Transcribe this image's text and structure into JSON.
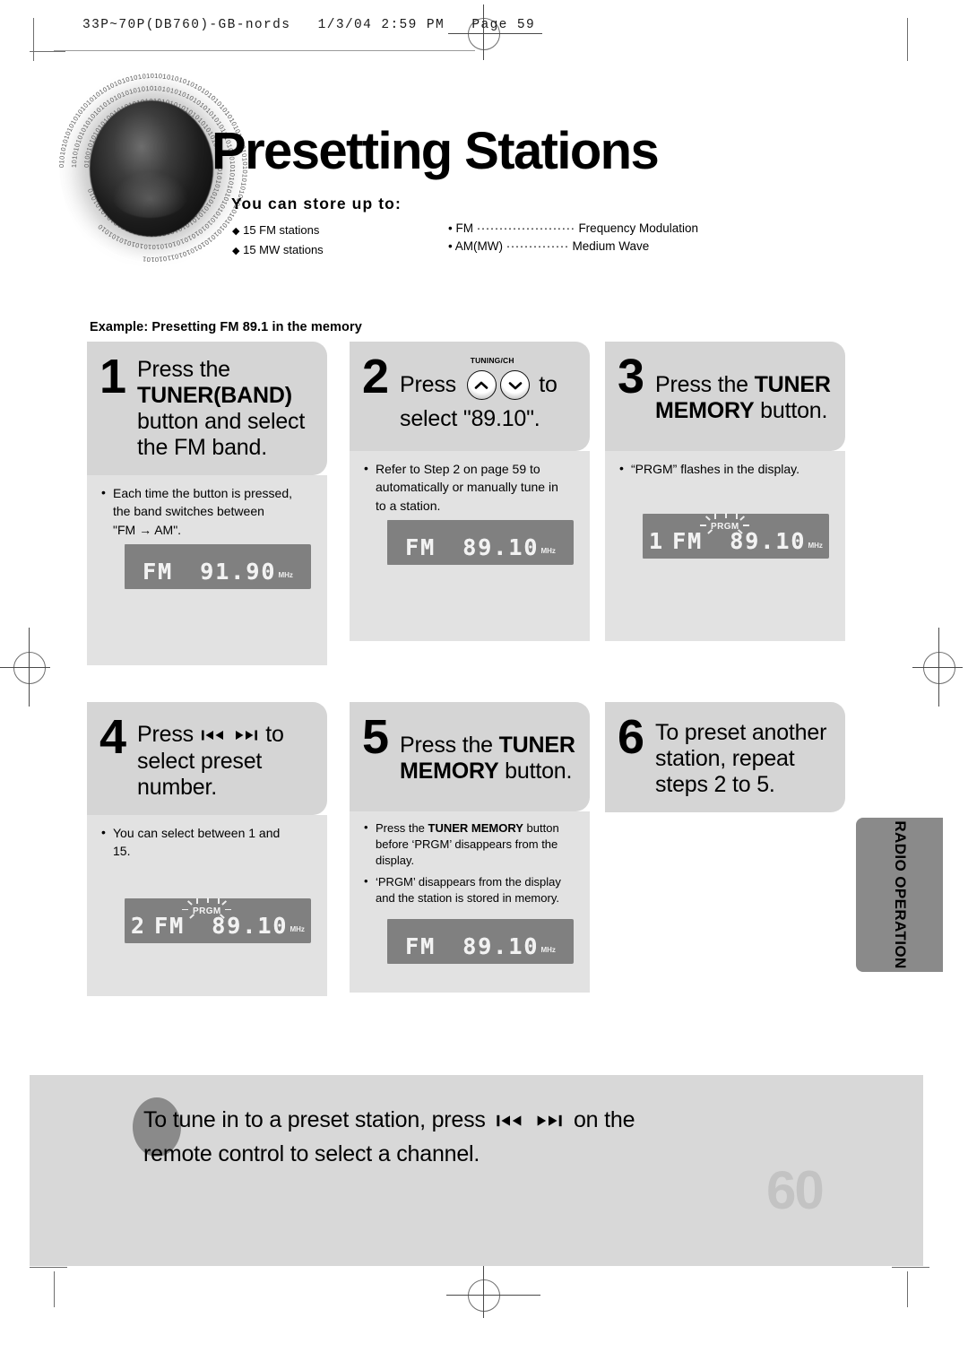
{
  "print_header": {
    "text": "33P~70P(DB760)-GB-nords   1/3/04 2:59 PM   Page 59"
  },
  "heading": {
    "title": "Presetting Stations",
    "store_label": "You can store up to:",
    "capacity": [
      "15 FM stations",
      "15 MW stations"
    ],
    "abbreviations": [
      {
        "term": "FM",
        "dots": "······················",
        "meaning": "Frequency Modulation"
      },
      {
        "term": "AM(MW)",
        "dots": "··············",
        "meaning": "Medium Wave"
      }
    ]
  },
  "example_caption": "Example: Presetting FM 89.1 in the memory",
  "steps": [
    {
      "number": "1",
      "text_lines": [
        {
          "plain": "Press the"
        },
        {
          "bold": "TUNER(BAND)"
        },
        {
          "plain": "button  and select"
        },
        {
          "plain": "the FM band."
        }
      ],
      "notes": [
        "Each time the button is pressed, the band switches between \"FM → AM\"."
      ],
      "lcd": {
        "preset": "",
        "band": "FM",
        "freq": "91.90",
        "unit": "MHz",
        "prgm": false
      }
    },
    {
      "number": "2",
      "text_lines": [
        {
          "plain": "Press",
          "icon": "tuning-buttons",
          "icon_label": "TUNING/CH",
          "plain_after": "to"
        },
        {
          "plain": "select \"89.10\"."
        }
      ],
      "notes": [
        "Refer to Step 2 on page 59 to automatically or manually tune in to a station."
      ],
      "lcd": {
        "preset": "",
        "band": "FM",
        "freq": "89.10",
        "unit": "MHz",
        "prgm": false
      }
    },
    {
      "number": "3",
      "text_lines": [
        {
          "plain": "Press the",
          "bold_after": "TUNER"
        },
        {
          "bold": "MEMORY",
          "plain_after": "button."
        }
      ],
      "notes": [
        "“PRGM” flashes in the display."
      ],
      "lcd": {
        "preset": "1",
        "band": "FM",
        "freq": "89.10",
        "unit": "MHz",
        "prgm": true
      }
    },
    {
      "number": "4",
      "text_lines": [
        {
          "plain": "Press",
          "icon": "skip-buttons",
          "plain_after": "to"
        },
        {
          "plain": "select preset"
        },
        {
          "plain": "number."
        }
      ],
      "notes": [
        "You can select between 1 and 15."
      ],
      "lcd": {
        "preset": "2",
        "band": "FM",
        "freq": "89.10",
        "unit": "MHz",
        "prgm": true
      }
    },
    {
      "number": "5",
      "text_lines": [
        {
          "plain": "Press the",
          "bold_after": "TUNER"
        },
        {
          "bold": "MEMORY",
          "plain_after": "button."
        }
      ],
      "notes": [
        "Press the TUNER MEMORY button before ‘PRGM’ disappears from the display.",
        "‘PRGM’ disappears from the display and the station is stored in memory."
      ],
      "lcd": {
        "preset": "",
        "band": "FM",
        "freq": "89.10",
        "unit": "MHz",
        "prgm": false
      }
    },
    {
      "number": "6",
      "text_lines": [
        {
          "plain": "To preset another"
        },
        {
          "plain": "station, repeat"
        },
        {
          "plain": "steps 2 to 5."
        }
      ],
      "notes": [],
      "lcd": null
    }
  ],
  "step_notes_text": {
    "s1_l1": "Each time the button is pressed,",
    "s1_l2": "the band switches between",
    "s1_l3": "\"FM → AM\".",
    "s2_l1": "Refer to Step 2 on page 59 to",
    "s2_l2": "automatically or manually tune in",
    "s2_l3": "to a station.",
    "s3_l1": "“PRGM” flashes in the display.",
    "s4_l1": "You can select between 1 and",
    "s4_l2": "15.",
    "s5_a1": "Press the ",
    "s5_a_bold": "TUNER MEMORY",
    "s5_a2": " button before ‘PRGM’ disappears from the display.",
    "s5_b": "‘PRGM’ disappears from the display and the station is stored in memory."
  },
  "step_headings": {
    "s1_l1": "Press the",
    "s1_l2": "TUNER(BAND)",
    "s1_l3": "button  and select",
    "s1_l4": "the FM band.",
    "s2_press": "Press",
    "s2_to": "to",
    "s2_l2": "select \"89.10\".",
    "s2_tuning_label": "TUNING/CH",
    "s3_l1a": "Press the ",
    "s3_l1b": "TUNER",
    "s3_l2a": "MEMORY",
    "s3_l2b": " button.",
    "s4_press": "Press",
    "s4_to": "to",
    "s4_l2": "select preset",
    "s4_l3": "number.",
    "s5_l1a": "Press the ",
    "s5_l1b": "TUNER",
    "s5_l2a": "MEMORY",
    "s5_l2b": " button.",
    "s6_l1": "To preset another",
    "s6_l2": "station, repeat",
    "s6_l3": "steps 2 to 5."
  },
  "lcd_displays": {
    "d1": {
      "preset": "",
      "band": "FM",
      "freq": "91.90",
      "unit": "MHz"
    },
    "d2": {
      "preset": "",
      "band": "FM",
      "freq": "89.10",
      "unit": "MHz"
    },
    "d3": {
      "preset": "1",
      "band": "FM",
      "freq": "89.10",
      "unit": "MHz",
      "prgm_label": "PRGM"
    },
    "d4": {
      "preset": "2",
      "band": "FM",
      "freq": "89.10",
      "unit": "MHz",
      "prgm_label": "PRGM"
    },
    "d5": {
      "preset": "",
      "band": "FM",
      "freq": "89.10",
      "unit": "MHz"
    }
  },
  "side_tab": {
    "label": "RADIO OPERATION"
  },
  "footer": {
    "callout_line1a": "To tune in to a preset station, press",
    "callout_line1b": "on the",
    "callout_line2": "remote control to select a channel.",
    "page_number": "60"
  },
  "colors": {
    "step_header_bg": "#d5d5d5",
    "notes_bg": "#e2e2e2",
    "lcd_bg": "#808080",
    "side_tab_bg": "#8a8a8a",
    "footer_band_bg": "#d8d8d8",
    "page_number": "#c3c3c3"
  }
}
